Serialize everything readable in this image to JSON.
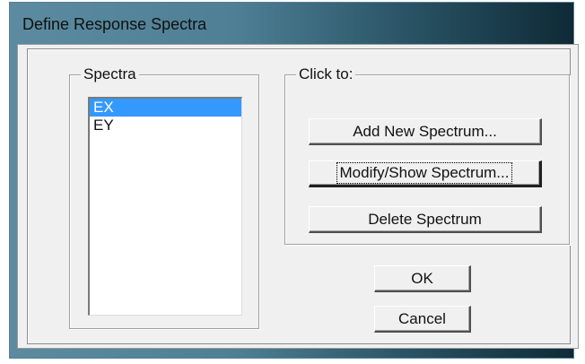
{
  "window": {
    "title": "Define Response Spectra"
  },
  "spectra": {
    "label": "Spectra",
    "items": [
      {
        "label": "EX",
        "selected": true
      },
      {
        "label": "EY",
        "selected": false
      }
    ]
  },
  "click_to": {
    "label": "Click to:",
    "add_label": "Add New Spectrum...",
    "modify_label": "Modify/Show Spectrum...",
    "delete_label": "Delete Spectrum"
  },
  "dialog_buttons": {
    "ok_label": "OK",
    "cancel_label": "Cancel"
  },
  "colors": {
    "selection": "#3399ff",
    "face": "#f0f0f0"
  }
}
